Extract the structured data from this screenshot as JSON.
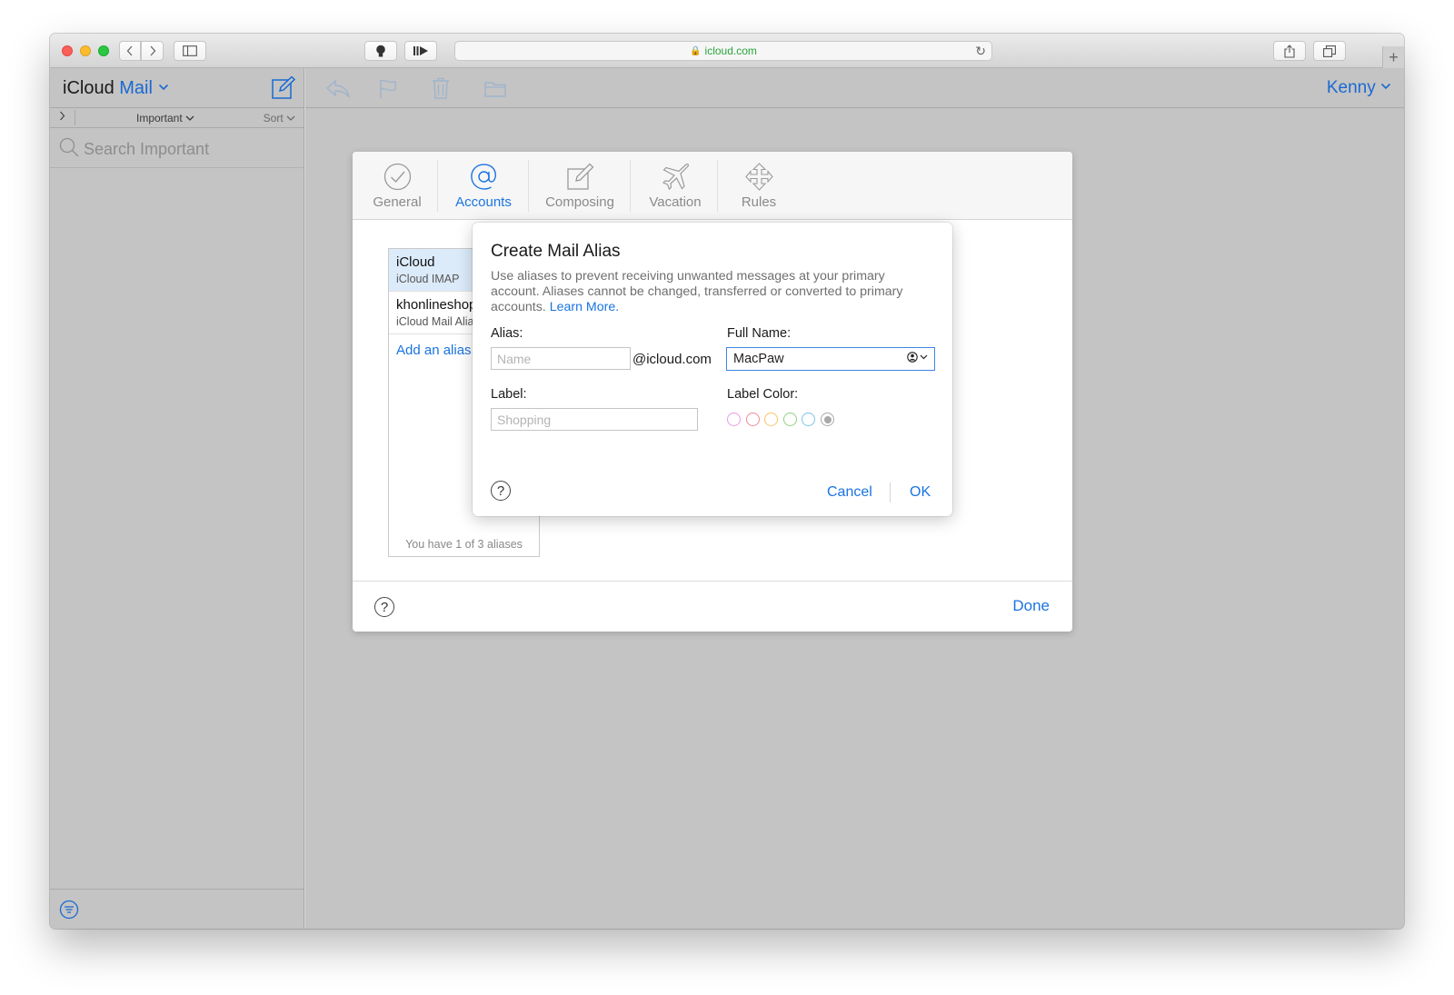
{
  "browser": {
    "url": "icloud.com"
  },
  "app": {
    "brand_prefix": "iCloud",
    "brand_app": "Mail",
    "user": "Kenny"
  },
  "sidebar": {
    "filter_label": "Important",
    "sort_label": "Sort",
    "search_placeholder": "Search Important"
  },
  "settings": {
    "tabs": [
      {
        "label": "General"
      },
      {
        "label": "Accounts"
      },
      {
        "label": "Composing"
      },
      {
        "label": "Vacation"
      },
      {
        "label": "Rules"
      }
    ],
    "active_tab": "Accounts",
    "accounts": [
      {
        "name": "iCloud",
        "sub": "iCloud IMAP"
      },
      {
        "name": "khonlineshop",
        "sub": "iCloud Mail Alias"
      }
    ],
    "add_alias": "Add an alias...",
    "alias_count": "You have 1 of 3 aliases",
    "help": "?",
    "done": "Done"
  },
  "alias_modal": {
    "title": "Create Mail Alias",
    "description": "Use aliases to prevent receiving unwanted messages at your primary account. Aliases cannot be changed, transferred or converted to primary accounts.",
    "learn_more": "Learn More.",
    "alias_label": "Alias:",
    "alias_placeholder": "Name",
    "alias_value": "",
    "domain": "@icloud.com",
    "fullname_label": "Full Name:",
    "fullname_value": "MacPaw",
    "label_label": "Label:",
    "label_placeholder": "Shopping",
    "label_value": "",
    "label_color_label": "Label Color:",
    "label_colors": [
      "#e99be6",
      "#f08a9a",
      "#f5c56a",
      "#8fd27e",
      "#7cc2ec",
      "#a9a9a9"
    ],
    "selected_color_index": 5,
    "help": "?",
    "cancel": "Cancel",
    "ok": "OK"
  }
}
